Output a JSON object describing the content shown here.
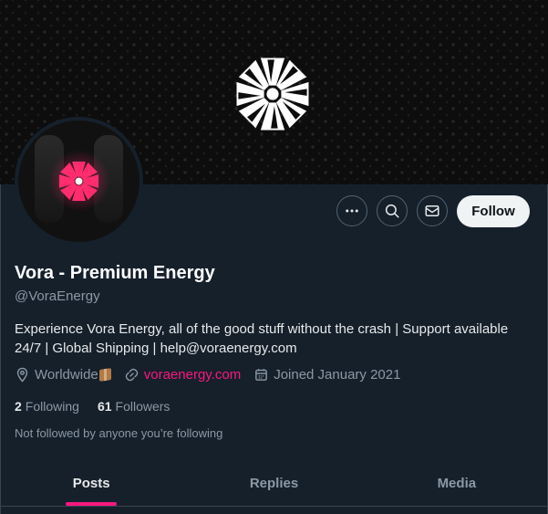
{
  "colors": {
    "background": "#15202b",
    "accent": "#f91880",
    "muted": "#8b98a5",
    "text": "#e7e9ea"
  },
  "header": {
    "banner_logo_icon": "vora-logo-icon",
    "avatar_icon": "vora-logo-icon"
  },
  "actions": {
    "more_icon": "more-horizontal-icon",
    "search_icon": "search-icon",
    "message_icon": "mail-icon",
    "follow_label": "Follow"
  },
  "profile": {
    "name": "Vora - Premium Energy",
    "handle": "@VoraEnergy",
    "bio": "Experience Vora Energy, all of the good stuff without the crash | Support available 24/7 | Global Shipping | help@voraenergy.com",
    "location": "Worldwide",
    "location_emoji": "package-icon",
    "website": "voraenergy.com",
    "joined": "Joined January 2021"
  },
  "stats": {
    "following_count": "2",
    "following_label": "Following",
    "followers_count": "61",
    "followers_label": "Followers"
  },
  "social_context": "Not followed by anyone you’re following",
  "tabs": [
    {
      "label": "Posts",
      "active": true
    },
    {
      "label": "Replies",
      "active": false
    },
    {
      "label": "Media",
      "active": false
    }
  ]
}
